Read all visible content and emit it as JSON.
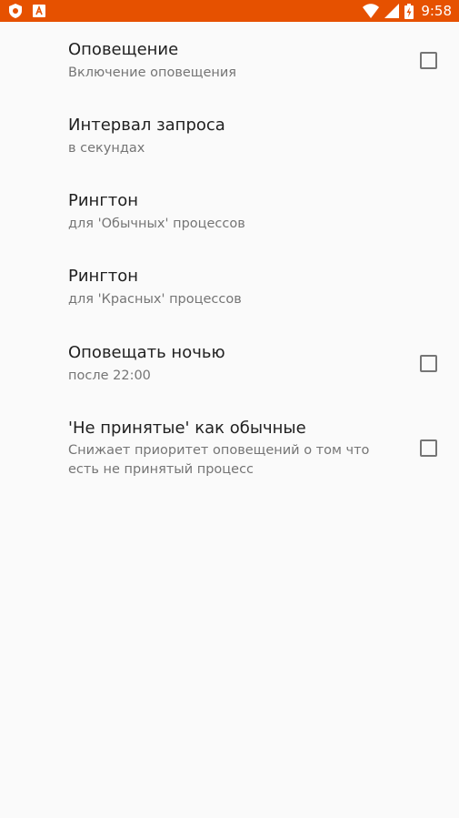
{
  "status_bar": {
    "time": "9:58",
    "left_icons": [
      "shield-notification-icon",
      "text-box-notification-icon"
    ],
    "right_icons": [
      "wifi-icon",
      "cell-signal-icon",
      "battery-charging-icon"
    ],
    "background_color": "#e65100"
  },
  "preferences": [
    {
      "title": "Оповещение",
      "summary": "Включение оповещения",
      "has_checkbox": true,
      "checked": false
    },
    {
      "title": "Интервал запроса",
      "summary": "в секундах",
      "has_checkbox": false
    },
    {
      "title": "Рингтон",
      "summary": "для 'Обычных' процессов",
      "has_checkbox": false
    },
    {
      "title": "Рингтон",
      "summary": "для 'Красных' процессов",
      "has_checkbox": false
    },
    {
      "title": "Оповещать ночью",
      "summary": "после 22:00",
      "has_checkbox": true,
      "checked": false
    },
    {
      "title": "'Не принятые' как обычные",
      "summary": "Снижает приоритет оповещений о том что есть не принятый процесс",
      "has_checkbox": true,
      "checked": false
    }
  ]
}
